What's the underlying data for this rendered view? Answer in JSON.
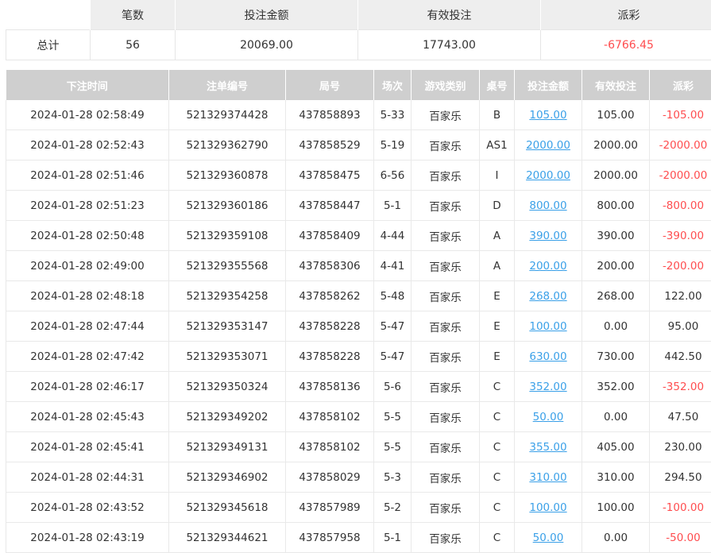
{
  "summary": {
    "headers": [
      "",
      "笔数",
      "投注金额",
      "有效投注",
      "派彩"
    ],
    "label": "总计",
    "count": "56",
    "bet_amount": "20069.00",
    "valid_bet": "17743.00",
    "payout": "-6766.45"
  },
  "columns": [
    "下注时间",
    "注单编号",
    "局号",
    "场次",
    "游戏类别",
    "桌号",
    "投注金额",
    "有效投注",
    "派彩"
  ],
  "rows": [
    [
      "2024-01-28 02:58:49",
      "521329374428",
      "437858893",
      "5-33",
      "百家乐",
      "B",
      "105.00",
      "105.00",
      "-105.00"
    ],
    [
      "2024-01-28 02:52:43",
      "521329362790",
      "437858529",
      "5-19",
      "百家乐",
      "AS1",
      "2000.00",
      "2000.00",
      "-2000.00"
    ],
    [
      "2024-01-28 02:51:46",
      "521329360878",
      "437858475",
      "6-56",
      "百家乐",
      "I",
      "2000.00",
      "2000.00",
      "-2000.00"
    ],
    [
      "2024-01-28 02:51:23",
      "521329360186",
      "437858447",
      "5-1",
      "百家乐",
      "D",
      "800.00",
      "800.00",
      "-800.00"
    ],
    [
      "2024-01-28 02:50:48",
      "521329359108",
      "437858409",
      "4-44",
      "百家乐",
      "A",
      "390.00",
      "390.00",
      "-390.00"
    ],
    [
      "2024-01-28 02:49:00",
      "521329355568",
      "437858306",
      "4-41",
      "百家乐",
      "A",
      "200.00",
      "200.00",
      "-200.00"
    ],
    [
      "2024-01-28 02:48:18",
      "521329354258",
      "437858262",
      "5-48",
      "百家乐",
      "E",
      "268.00",
      "268.00",
      "122.00"
    ],
    [
      "2024-01-28 02:47:44",
      "521329353147",
      "437858228",
      "5-47",
      "百家乐",
      "E",
      "100.00",
      "0.00",
      "95.00"
    ],
    [
      "2024-01-28 02:47:42",
      "521329353071",
      "437858228",
      "5-47",
      "百家乐",
      "E",
      "630.00",
      "730.00",
      "442.50"
    ],
    [
      "2024-01-28 02:46:17",
      "521329350324",
      "437858136",
      "5-6",
      "百家乐",
      "C",
      "352.00",
      "352.00",
      "-352.00"
    ],
    [
      "2024-01-28 02:45:43",
      "521329349202",
      "437858102",
      "5-5",
      "百家乐",
      "C",
      "50.00",
      "0.00",
      "47.50"
    ],
    [
      "2024-01-28 02:45:41",
      "521329349131",
      "437858102",
      "5-5",
      "百家乐",
      "C",
      "355.00",
      "405.00",
      "230.00"
    ],
    [
      "2024-01-28 02:44:31",
      "521329346902",
      "437858029",
      "5-3",
      "百家乐",
      "C",
      "310.00",
      "310.00",
      "294.50"
    ],
    [
      "2024-01-28 02:43:52",
      "521329345618",
      "437857989",
      "5-2",
      "百家乐",
      "C",
      "100.00",
      "100.00",
      "-100.00"
    ],
    [
      "2024-01-28 02:43:19",
      "521329344621",
      "437857958",
      "5-1",
      "百家乐",
      "C",
      "50.00",
      "0.00",
      "-50.00"
    ]
  ],
  "colors": {
    "negative": "#ff4d4f",
    "link": "#3aa0e8",
    "header_bg": "#cfcfcf"
  }
}
